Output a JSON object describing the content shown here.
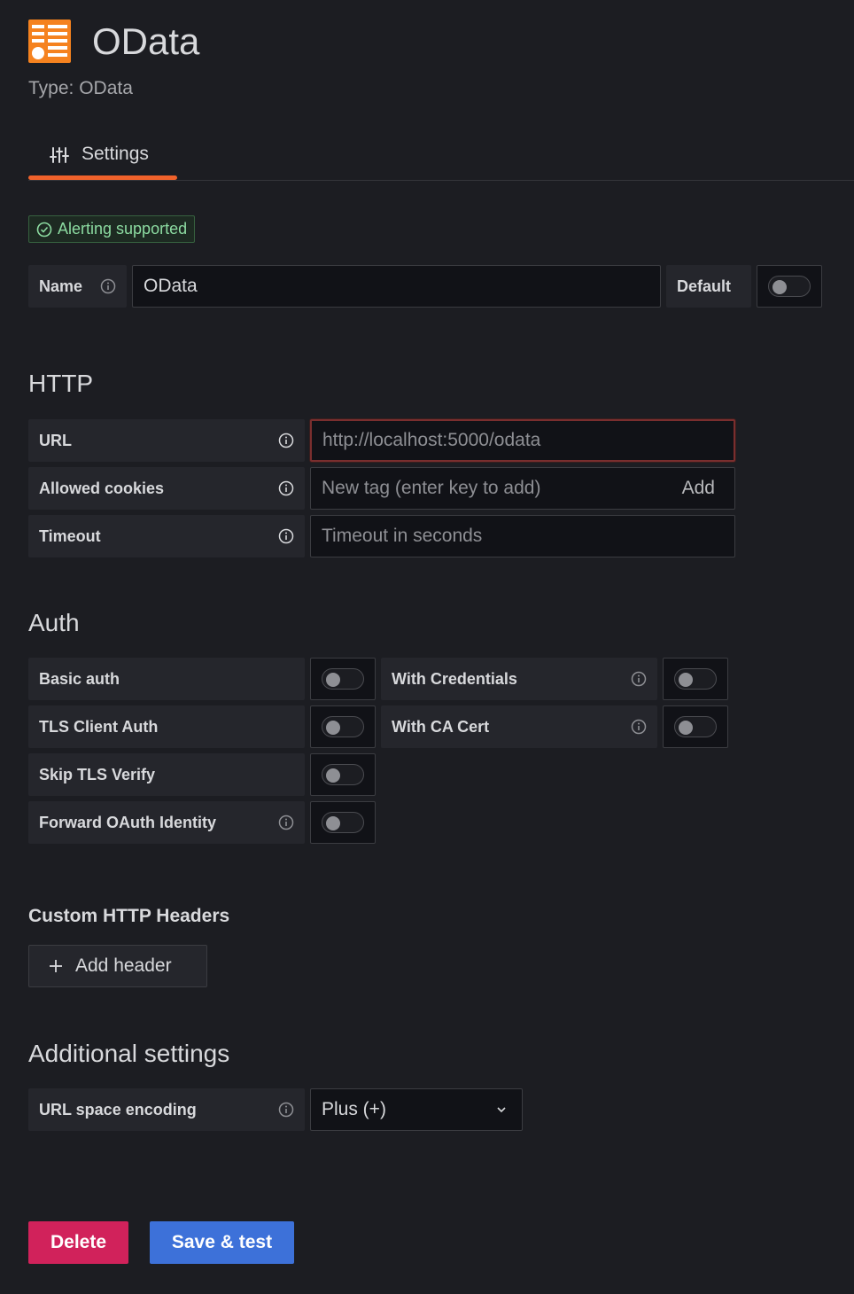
{
  "header": {
    "title": "OData",
    "subtitle": "Type: OData",
    "logo_color": "#f5821f"
  },
  "tabs": [
    {
      "label": "Settings",
      "icon": "sliders-icon",
      "active": true
    }
  ],
  "badge": {
    "text": "Alerting supported",
    "icon": "check-circle-icon"
  },
  "name_row": {
    "label": "Name",
    "value": "OData",
    "default_label": "Default",
    "default_on": false
  },
  "http": {
    "title": "HTTP",
    "url": {
      "label": "URL",
      "placeholder": "http://localhost:5000/odata"
    },
    "cookies": {
      "label": "Allowed cookies",
      "placeholder": "New tag (enter key to add)",
      "add_label": "Add"
    },
    "timeout": {
      "label": "Timeout",
      "placeholder": "Timeout in seconds"
    }
  },
  "auth": {
    "title": "Auth",
    "basic_auth": "Basic auth",
    "tls_client_auth": "TLS Client Auth",
    "skip_tls_verify": "Skip TLS Verify",
    "forward_oauth": "Forward OAuth Identity",
    "with_credentials": "With Credentials",
    "with_ca_cert": "With CA Cert"
  },
  "headers": {
    "title": "Custom HTTP Headers",
    "add_label": "Add header"
  },
  "additional": {
    "title": "Additional settings",
    "url_encoding_label": "URL space encoding",
    "url_encoding_value": "Plus (+)"
  },
  "actions": {
    "delete_label": "Delete",
    "save_label": "Save & test"
  },
  "colors": {
    "accent_tab": "#f0622b",
    "danger": "#d1225b",
    "primary": "#3d71d9",
    "success": "#8cdba1"
  }
}
